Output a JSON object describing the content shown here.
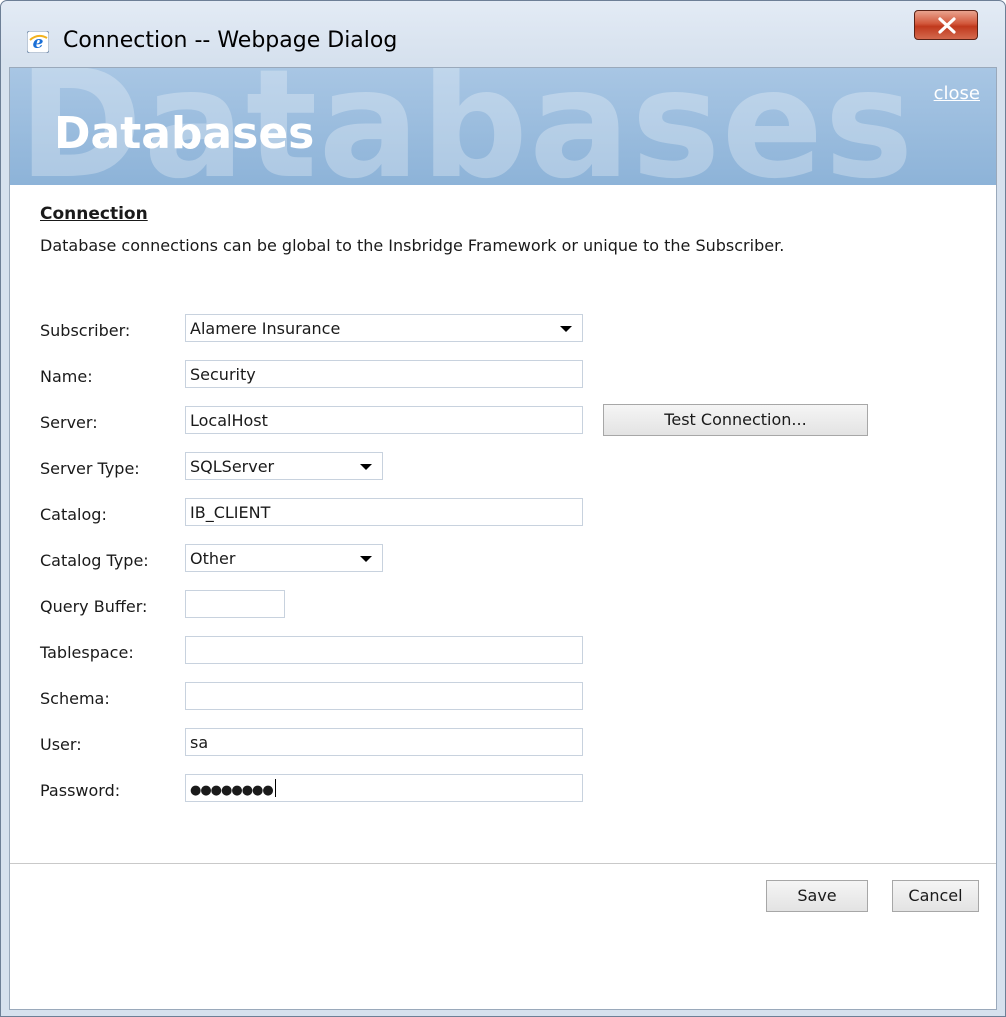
{
  "window": {
    "title": "Connection -- Webpage Dialog",
    "icon": "ie-icon",
    "close_icon": "close-x-icon",
    "close_color": "#c9432a"
  },
  "banner": {
    "watermark": "Databases",
    "title": "Databases",
    "close_link": "close",
    "color": "#98bbdd"
  },
  "section": {
    "heading": "Connection",
    "description": "Database connections can be global to the Insbridge Framework or unique to the Subscriber."
  },
  "form": {
    "subscriber": {
      "label": "Subscriber:",
      "value": "Alamere Insurance"
    },
    "name": {
      "label": "Name:",
      "value": "Security"
    },
    "server": {
      "label": "Server:",
      "value": "LocalHost"
    },
    "server_type": {
      "label": "Server Type:",
      "value": "SQLServer"
    },
    "catalog": {
      "label": "Catalog:",
      "value": "IB_CLIENT"
    },
    "catalog_type": {
      "label": "Catalog Type:",
      "value": "Other"
    },
    "query_buffer": {
      "label": "Query Buffer:",
      "value": ""
    },
    "tablespace": {
      "label": "Tablespace:",
      "value": ""
    },
    "schema": {
      "label": "Schema:",
      "value": ""
    },
    "user": {
      "label": "User:",
      "value": "sa"
    },
    "password": {
      "label": "Password:",
      "value": "●●●●●●●●"
    }
  },
  "buttons": {
    "test_connection": "Test Connection...",
    "save": "Save",
    "cancel": "Cancel"
  }
}
